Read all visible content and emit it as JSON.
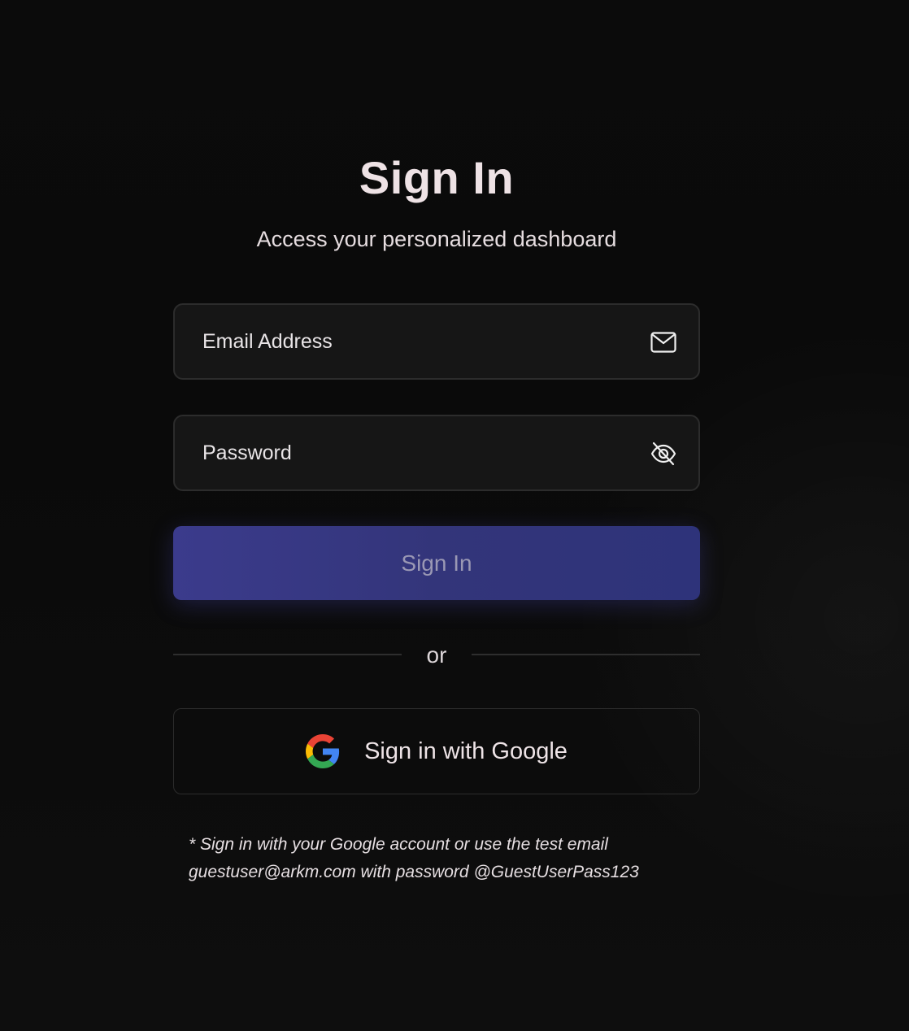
{
  "header": {
    "title": "Sign In",
    "subtitle": "Access your personalized dashboard"
  },
  "form": {
    "email": {
      "placeholder": "Email Address",
      "value": "",
      "icon": "mail-icon"
    },
    "password": {
      "placeholder": "Password",
      "value": "",
      "icon": "eye-off-icon"
    },
    "submit_label": "Sign In",
    "divider_text": "or",
    "google_label": "Sign in with Google",
    "google_icon": "google-icon"
  },
  "note": {
    "line1": "* Sign in with your Google account or use the test email",
    "line2": "guestuser@arkm.com with password @GuestUserPass123"
  },
  "colors": {
    "background": "#0a0a0a",
    "primary_button": "#35377f",
    "primary_button_text": "#9a98b4",
    "field_background": "#161616",
    "field_border": "#2c2c2c"
  }
}
